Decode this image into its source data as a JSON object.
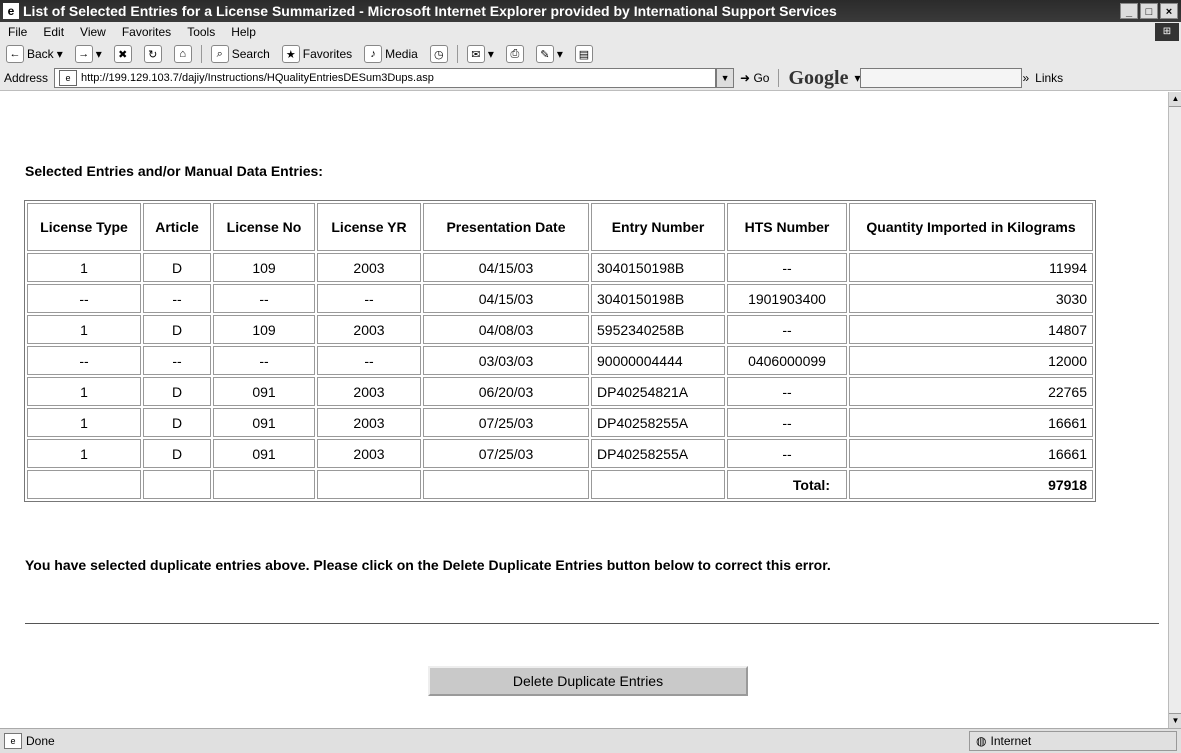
{
  "window": {
    "title": "List of Selected Entries for a License Summarized - Microsoft Internet Explorer provided by International Support Services"
  },
  "menu": [
    "File",
    "Edit",
    "View",
    "Favorites",
    "Tools",
    "Help"
  ],
  "toolbar": {
    "back": "Back",
    "search": "Search",
    "favorites": "Favorites",
    "media": "Media"
  },
  "address": {
    "label": "Address",
    "url": "http://199.129.103.7/dajiy/Instructions/HQualityEntriesDESum3Dups.asp",
    "go": "Go",
    "google": "Google",
    "links": "Links"
  },
  "page": {
    "heading": "Selected Entries and/or Manual Data Entries:",
    "columns": [
      "License Type",
      "Article",
      "License No",
      "License YR",
      "Presentation Date",
      "Entry Number",
      "HTS Number",
      "Quantity Imported in Kilograms"
    ],
    "rows": [
      [
        "1",
        "D",
        "109",
        "2003",
        "04/15/03",
        "3040150198B",
        "--",
        "11994"
      ],
      [
        "--",
        "--",
        "--",
        "--",
        "04/15/03",
        "3040150198B",
        "1901903400",
        "3030"
      ],
      [
        "1",
        "D",
        "109",
        "2003",
        "04/08/03",
        "5952340258B",
        "--",
        "14807"
      ],
      [
        "--",
        "--",
        "--",
        "--",
        "03/03/03",
        "90000004444",
        "0406000099",
        "12000"
      ],
      [
        "1",
        "D",
        "091",
        "2003",
        "06/20/03",
        "DP40254821A",
        "--",
        "22765"
      ],
      [
        "1",
        "D",
        "091",
        "2003",
        "07/25/03",
        "DP40258255A",
        "--",
        "16661"
      ],
      [
        "1",
        "D",
        "091",
        "2003",
        "07/25/03",
        "DP40258255A",
        "--",
        "16661"
      ]
    ],
    "total_label": "Total:",
    "total_value": "97918",
    "message": "You have selected duplicate entries above. Please click on the Delete Duplicate Entries button below to correct this error.",
    "delete_button": "Delete Duplicate Entries"
  },
  "status": {
    "text": "Done",
    "zone": "Internet"
  }
}
